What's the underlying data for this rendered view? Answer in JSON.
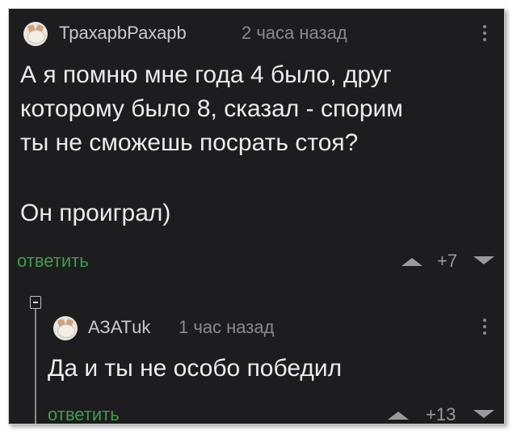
{
  "comments": [
    {
      "author": "ТрахарbРахарb",
      "time": "2 часа назад",
      "text_lines": [
        "А я помню мне года 4 было, друг",
        "которому было 8, сказал - спорим",
        "ты не сможешь посрать стоя?",
        "Он проиграл)"
      ],
      "reply_label": "ответить",
      "score": "+7"
    },
    {
      "author": "АЗАТuk",
      "time": "1 час назад",
      "text_lines": [
        "Да и ты не особо победил"
      ],
      "reply_label": "ответить",
      "score": "+13"
    }
  ],
  "colors": {
    "background": "#1d1d1f",
    "reply_link": "#3f9d4a",
    "text": "#ececec",
    "meta": "#8a8a8a"
  },
  "icons": [
    "kebab-menu-icon",
    "upvote-arrow-icon",
    "downvote-arrow-icon",
    "collapse-thread-icon",
    "avatar-icon"
  ]
}
